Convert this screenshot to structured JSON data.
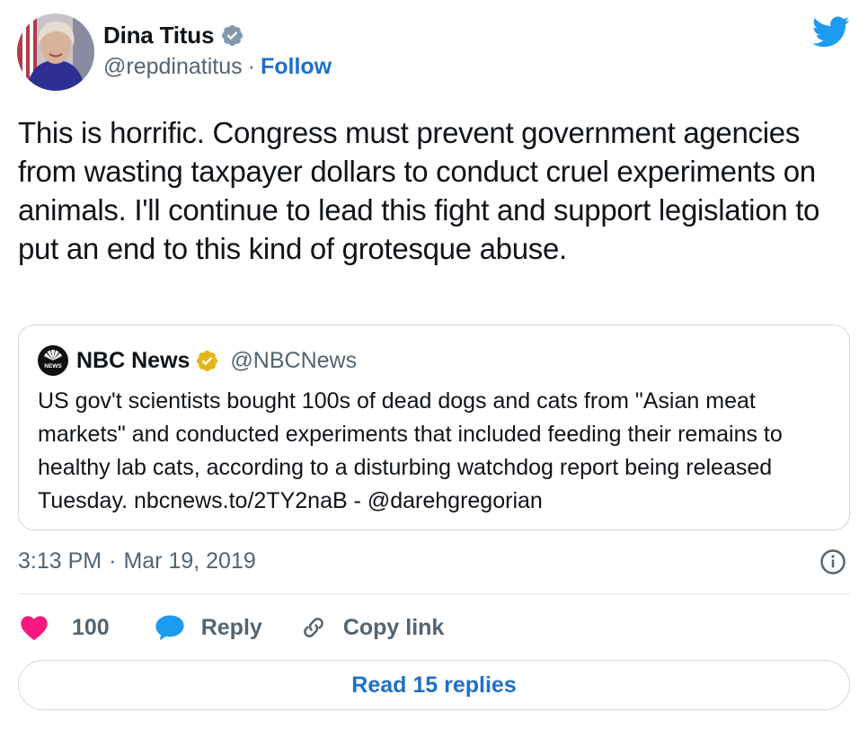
{
  "author": {
    "name": "Dina Titus",
    "handle": "@repdinatitus",
    "separator": "·",
    "follow_label": "Follow"
  },
  "tweet": {
    "text": "This is horrific. Congress must prevent government agencies from wasting taxpayer dollars to conduct cruel experiments on animals. I'll continue to lead this fight and support legislation to put an end to this kind of grotesque abuse."
  },
  "quoted": {
    "name": "NBC News",
    "handle": "@NBCNews",
    "logo_text": "NEWS",
    "text": "US gov't scientists bought 100s of dead dogs and cats from \"Asian meat markets\" and conducted experiments that included feeding their remains to healthy lab cats, according to a disturbing watchdog report being released Tuesday. nbcnews.to/2TY2naB - @darehgregorian"
  },
  "meta": {
    "time": "3:13 PM",
    "separator": "·",
    "date": "Mar 19, 2019"
  },
  "actions": {
    "like_count": "100",
    "reply_label": "Reply",
    "copy_label": "Copy link"
  },
  "read_replies_label": "Read 15 replies",
  "colors": {
    "brand_blue": "#1d9bf0",
    "link_blue": "#1d70c8",
    "like_pink": "#f91880",
    "verified_gold": "#e2b719",
    "muted_text": "#536471",
    "border": "#cfd9de"
  },
  "icons": {
    "verified": "verified-badge-icon",
    "bird": "twitter-bird-icon",
    "info": "info-icon",
    "like": "heart-icon",
    "reply": "speech-bubble-icon",
    "copy": "link-icon"
  }
}
